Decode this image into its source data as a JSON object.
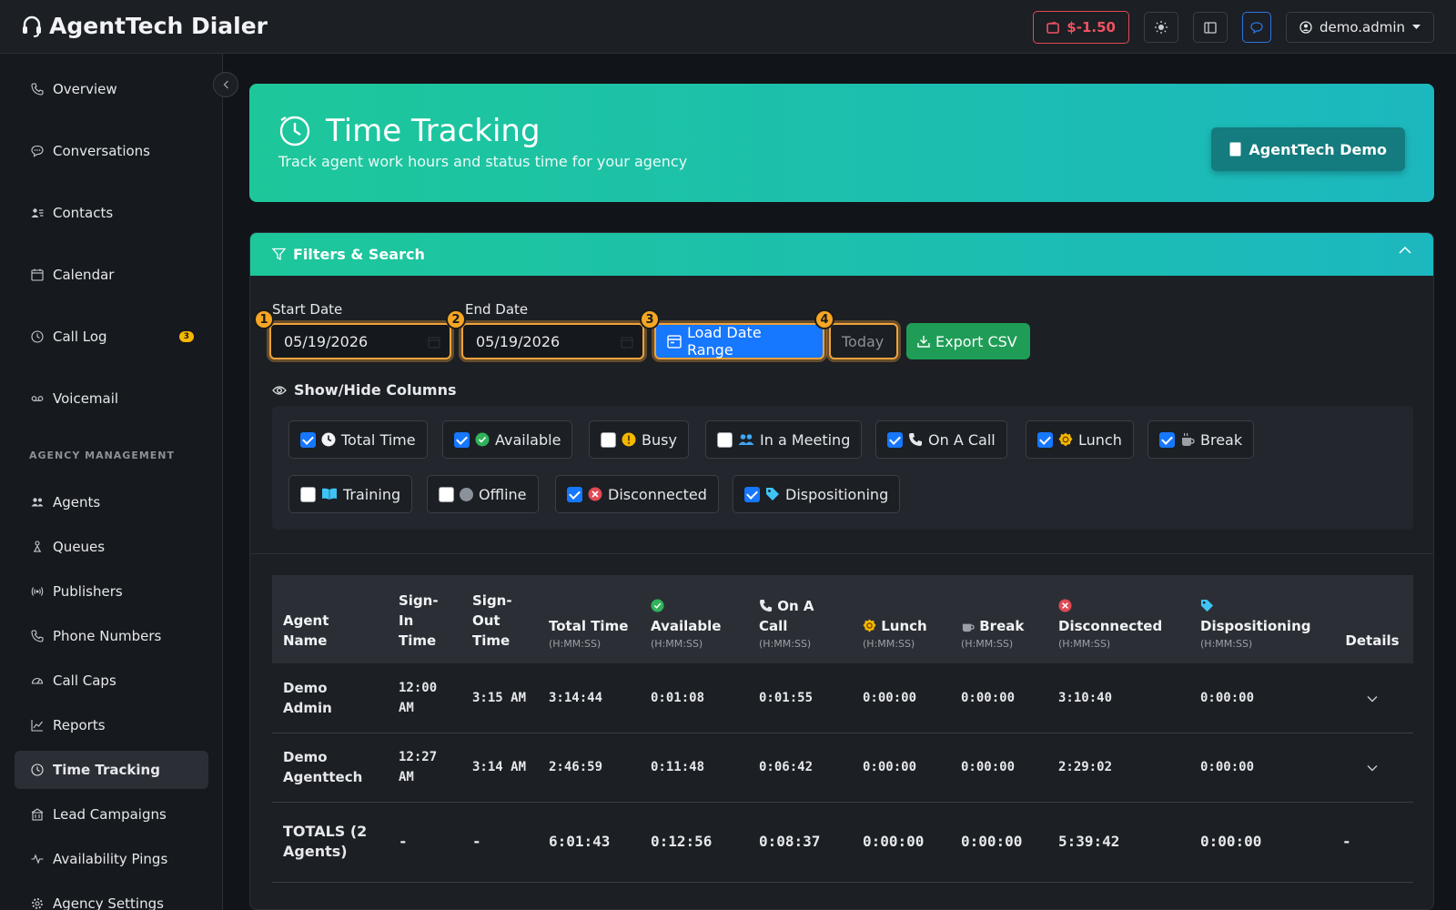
{
  "app": {
    "title": "AgentTech Dialer",
    "balance": "$-1.50",
    "user": "demo.admin"
  },
  "sidebar": {
    "items": [
      {
        "label": "Overview",
        "icon": "phone-icon"
      },
      {
        "label": "Conversations",
        "icon": "chat-icon"
      },
      {
        "label": "Contacts",
        "icon": "contacts-icon"
      },
      {
        "label": "Calendar",
        "icon": "calendar-icon"
      },
      {
        "label": "Call Log",
        "icon": "clock-icon",
        "badge": "3"
      },
      {
        "label": "Voicemail",
        "icon": "voicemail-icon"
      }
    ],
    "section_label": "AGENCY MANAGEMENT",
    "mgmt_items": [
      {
        "label": "Agents",
        "icon": "users-icon"
      },
      {
        "label": "Queues",
        "icon": "queue-icon"
      },
      {
        "label": "Publishers",
        "icon": "broadcast-icon"
      },
      {
        "label": "Phone Numbers",
        "icon": "phone-icon"
      },
      {
        "label": "Call Caps",
        "icon": "gauge-icon"
      },
      {
        "label": "Reports",
        "icon": "chart-icon"
      },
      {
        "label": "Time Tracking",
        "icon": "clock-icon",
        "active": true
      },
      {
        "label": "Lead Campaigns",
        "icon": "building-icon"
      },
      {
        "label": "Availability Pings",
        "icon": "pulse-icon"
      },
      {
        "label": "Agency Settings",
        "icon": "gear-icon"
      }
    ]
  },
  "hero": {
    "title": "Time Tracking",
    "subtitle": "Track agent work hours and status time for your agency",
    "agency_button": "AgentTech Demo"
  },
  "filters": {
    "title": "Filters & Search",
    "start_label": "Start Date",
    "end_label": "End Date",
    "start_value": "05/19/2026",
    "end_value": "05/19/2026",
    "load_button": "Load Date Range",
    "today_button": "Today",
    "export_button": "Export CSV",
    "step_badges": [
      "1",
      "2",
      "3",
      "4"
    ],
    "columns_title": "Show/Hide Columns",
    "columns": [
      {
        "label": "Total Time",
        "checked": true,
        "icon": "clock-icon"
      },
      {
        "label": "Available",
        "checked": true,
        "icon": "check-circle-icon",
        "color": "#2fb35a"
      },
      {
        "label": "Busy",
        "checked": false,
        "icon": "alert-circle-icon",
        "color": "#f5b800"
      },
      {
        "label": "In a Meeting",
        "checked": false,
        "icon": "people-icon",
        "color": "#3fa9f5"
      },
      {
        "label": "On A Call",
        "checked": true,
        "icon": "phone-icon"
      },
      {
        "label": "Lunch",
        "checked": true,
        "icon": "lunch-icon",
        "color": "#f5b800"
      },
      {
        "label": "Break",
        "checked": true,
        "icon": "coffee-icon"
      },
      {
        "label": "Training",
        "checked": false,
        "icon": "book-icon",
        "color": "#3fc4f5"
      },
      {
        "label": "Offline",
        "checked": false,
        "icon": "offline-dot-icon",
        "color": "#8b9199"
      },
      {
        "label": "Disconnected",
        "checked": true,
        "icon": "x-circle-icon",
        "color": "#e04a55"
      },
      {
        "label": "Dispositioning",
        "checked": true,
        "icon": "tag-icon",
        "color": "#3fc4f5"
      }
    ]
  },
  "table": {
    "headers": {
      "agent": "Agent Name",
      "signin": "Sign-In Time",
      "signout": "Sign-Out Time",
      "total": "Total Time",
      "available": "Available",
      "oncall": "On A Call",
      "lunch": "Lunch",
      "break": "Break",
      "disconnected": "Disconnected",
      "dispositioning": "Dispositioning",
      "details": "Details",
      "unit": "(H:MM:SS)"
    },
    "rows": [
      {
        "agent": "Demo Admin",
        "signin": "12:00 AM",
        "signout": "3:15 AM",
        "total": "3:14:44",
        "available": "0:01:08",
        "oncall": "0:01:55",
        "lunch": "0:00:00",
        "break": "0:00:00",
        "disconnected": "3:10:40",
        "dispositioning": "0:00:00"
      },
      {
        "agent": "Demo Agenttech",
        "signin": "12:27 AM",
        "signout": "3:14 AM",
        "total": "2:46:59",
        "available": "0:11:48",
        "oncall": "0:06:42",
        "lunch": "0:00:00",
        "break": "0:00:00",
        "disconnected": "2:29:02",
        "dispositioning": "0:00:00"
      }
    ],
    "totals": {
      "agent": "TOTALS (2 Agents)",
      "signin": "-",
      "signout": "-",
      "total": "6:01:43",
      "available": "0:12:56",
      "oncall": "0:08:37",
      "lunch": "0:00:00",
      "break": "0:00:00",
      "disconnected": "5:39:42",
      "dispositioning": "0:00:00",
      "details": "-"
    }
  }
}
